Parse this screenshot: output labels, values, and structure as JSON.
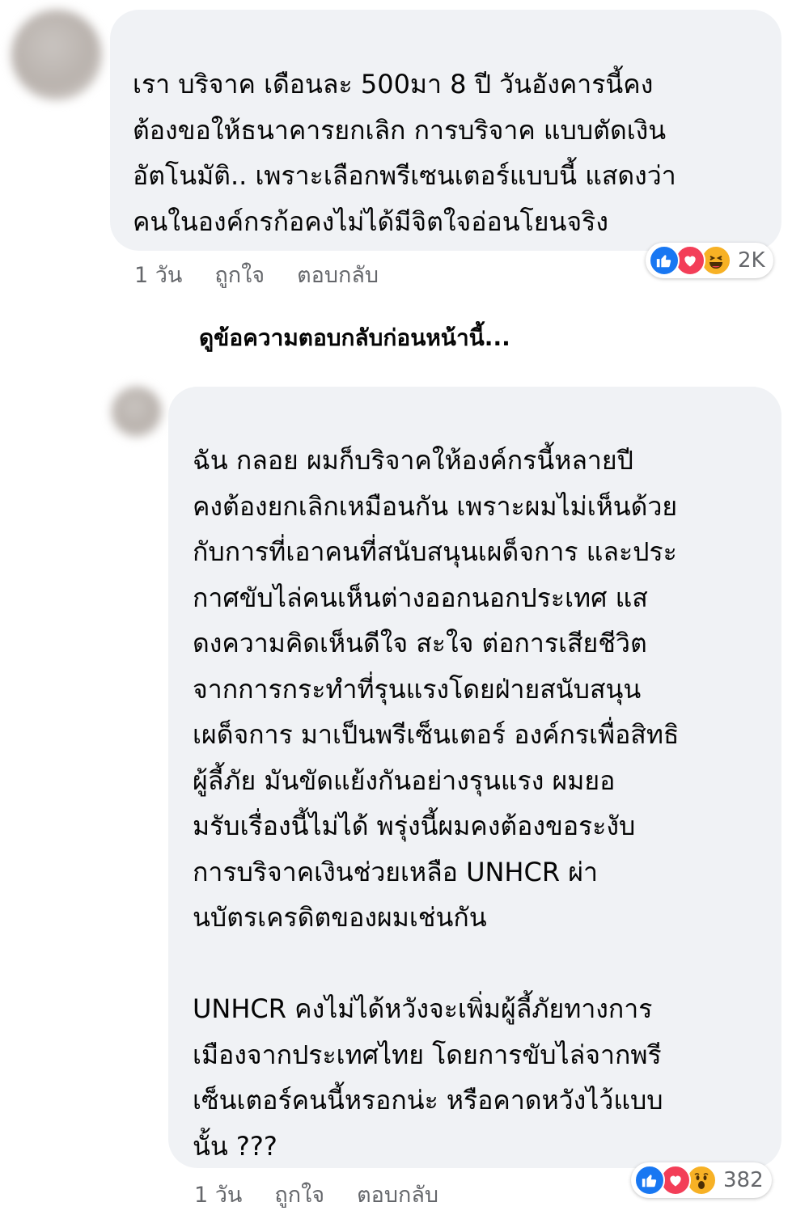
{
  "comments": [
    {
      "text": "เรา บริจาค เดือนละ 500มา 8 ปี  วันอังคารนี้คง\nต้องขอให้ธนาคารยกเลิก การบริจาค แบบตัดเงิน\nอัตโนมัติ.. เพราะเลือกพรีเซนเตอร์แบบนี้ แสดงว่า\nคนในองค์กรก้อคงไม่ได้มีจิตใจอ่อนโยนจริง",
      "time": "1 วัน",
      "like_label": "ถูกใจ",
      "reply_label": "ตอบกลับ",
      "reaction_count": "2K",
      "reactions": [
        "like-icon",
        "love-icon",
        "haha-icon"
      ]
    },
    {
      "text": "ฉัน กลอย ผมก็บริจาคให้องค์กรนี้หลายปี\nคงต้องยกเลิกเหมือนกัน เพราะผมไม่เห็นด้วย\nกับการที่เอาคนที่สนับสนุนเผด็จการ และประ\nกาศขับไล่คนเห็นต่างออกนอกประเทศ แส\nดงความคิดเห็นดีใจ สะใจ ต่อการเสียชีวิต\nจากการกระทำที่รุนแรงโดยฝ่ายสนับสนุน\nเผด็จการ มาเป็นพรีเซ็นเตอร์ องค์กรเพื่อสิทธิ\nผู้ลี้ภัย มันขัดแย้งกันอย่างรุนแรง ผมยอ\nมรับเรื่องนี้ไม่ได้  พรุ่งนี้ผมคงต้องขอระงับ\nการบริจาคเงินช่วยเหลือ UNHCR ผ่า\nนบัตรเครดิตของผมเช่นกัน\n\nUNHCR คงไม่ได้หวังจะเพิ่มผู้ลี้ภัยทางการ\nเมืองจากประเทศไทย โดยการขับไล่จากพรี\nเซ็นเตอร์คนนี้หรอกน่ะ หรือคาดหวังไว้แบบ\nนั้น ???",
      "time": "1 วัน",
      "like_label": "ถูกใจ",
      "reply_label": "ตอบกลับ",
      "reaction_count": "382",
      "reactions": [
        "like-icon",
        "love-icon",
        "wow-icon"
      ]
    }
  ],
  "view_previous_replies": "ดูข้อความตอบกลับก่อนหน้านี้...",
  "colors": {
    "bubble": "#f0f2f5",
    "meta_text": "#65676b",
    "like": "#1877f2",
    "love": "#f33e58",
    "emoji": "#f7b125"
  }
}
